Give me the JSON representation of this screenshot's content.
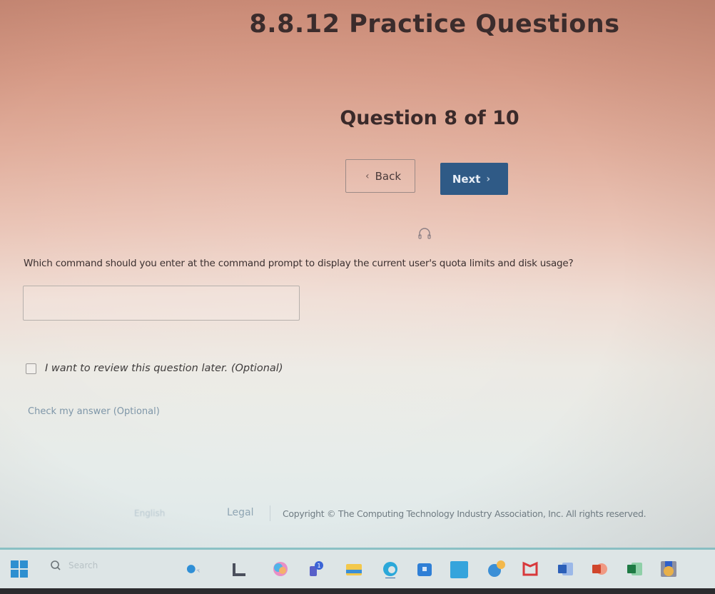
{
  "page": {
    "title": "8.8.12 Practice Questions",
    "question_counter": "Question 8 of 10"
  },
  "nav": {
    "back_label": "Back",
    "next_label": "Next",
    "back_chevron": "‹",
    "next_chevron": "›",
    "next_color": "#2f5a86"
  },
  "question": {
    "text": "Which command should you enter at the command prompt to display the current user's quota limits and disk usage?",
    "answer_value": "",
    "answer_placeholder": "",
    "audio_icon": "headphones-icon"
  },
  "review": {
    "label": "I want to review this question later. (Optional)",
    "checked": false
  },
  "check_answer_label": "Check my answer (Optional)",
  "footer": {
    "language": "English",
    "legal_label": "Legal",
    "copyright": "Copyright © The Computing Technology Industry Association, Inc. All rights reserved."
  },
  "taskbar": {
    "search_placeholder": "Search",
    "icons": [
      "windows-start-icon",
      "search-icon",
      "weather-icon",
      "app-l-icon",
      "copilot-icon",
      "teams-icon",
      "file-explorer-icon",
      "edge-icon",
      "microsoft-store-icon",
      "app-tile-icon",
      "help-icon",
      "mcafee-icon",
      "word-icon",
      "powerpoint-icon",
      "excel-icon",
      "app-generic-icon"
    ],
    "teams_badge": "1"
  }
}
